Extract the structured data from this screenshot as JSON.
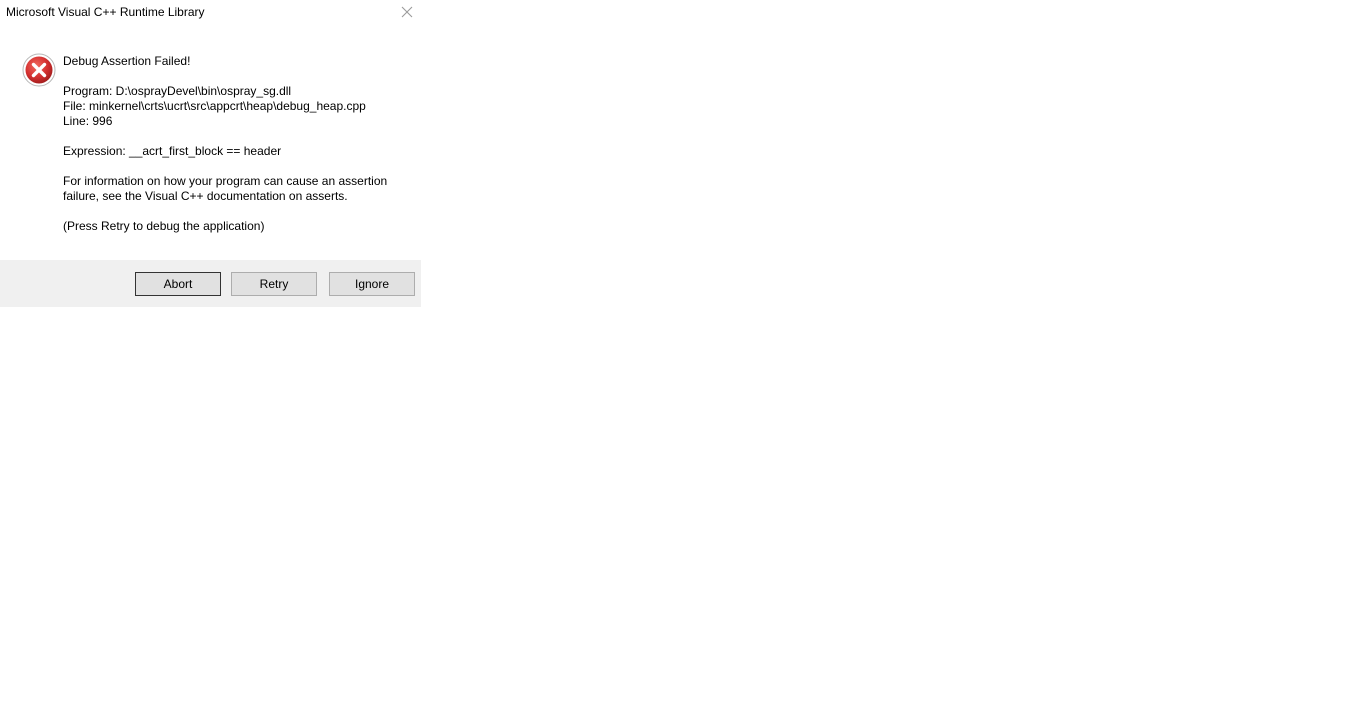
{
  "window": {
    "title": "Microsoft Visual C++ Runtime Library",
    "icon": "error-icon",
    "close_icon": "close-icon"
  },
  "message": {
    "heading": "Debug Assertion Failed!",
    "program": "Program: D:\\osprayDevel\\bin\\ospray_sg.dll",
    "file": "File: minkernel\\crts\\ucrt\\src\\appcrt\\heap\\debug_heap.cpp",
    "line": "Line: 996",
    "expression": "Expression: __acrt_first_block == header",
    "info_line1": "For information on how your program can cause an assertion",
    "info_line2": "failure, see the Visual C++ documentation on asserts.",
    "hint": "(Press Retry to debug the application)"
  },
  "buttons": {
    "abort": "Abort",
    "retry": "Retry",
    "ignore": "Ignore"
  },
  "colors": {
    "error_red": "#d93025",
    "footer_bg": "#f0f0f0"
  }
}
